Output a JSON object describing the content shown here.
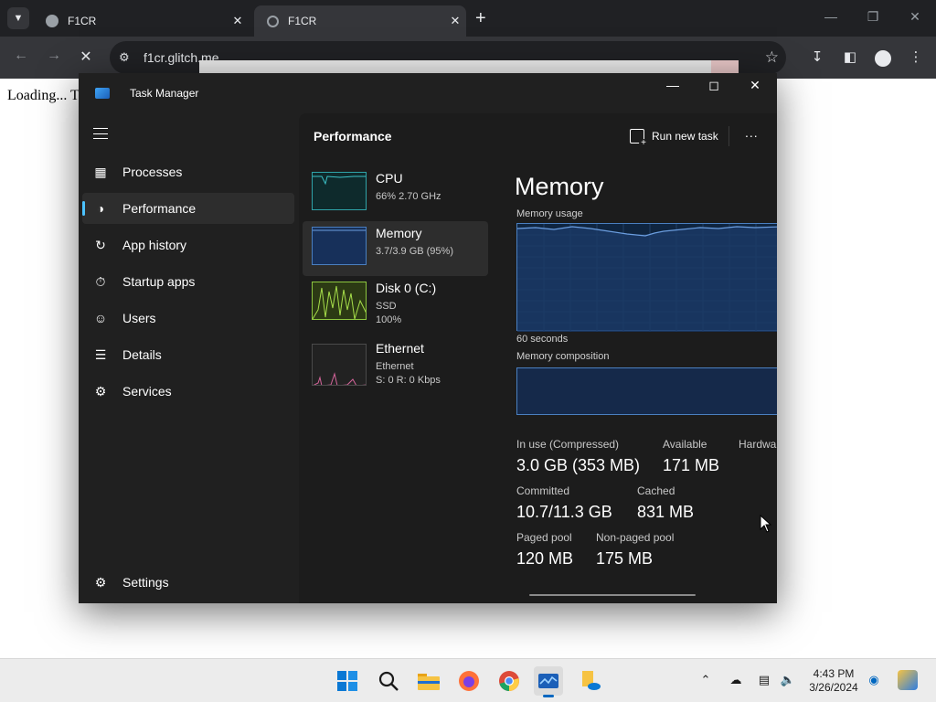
{
  "browser": {
    "tabs": [
      {
        "title": "F1CR"
      },
      {
        "title": "F1CR"
      }
    ],
    "new_tab_glyph": "+",
    "address": "f1cr.glitch.me",
    "page_text": "Loading... T"
  },
  "task_manager": {
    "title": "Task Manager",
    "sidebar": {
      "items": [
        {
          "label": "Processes",
          "icon": "processes-icon",
          "active": false
        },
        {
          "label": "Performance",
          "icon": "performance-icon",
          "active": true
        },
        {
          "label": "App history",
          "icon": "app-history-icon",
          "active": false
        },
        {
          "label": "Startup apps",
          "icon": "startup-apps-icon",
          "active": false
        },
        {
          "label": "Users",
          "icon": "users-icon",
          "active": false
        },
        {
          "label": "Details",
          "icon": "details-icon",
          "active": false
        },
        {
          "label": "Services",
          "icon": "services-icon",
          "active": false
        }
      ],
      "settings_label": "Settings"
    },
    "header": {
      "title": "Performance",
      "run_new_task": "Run new task",
      "more": "..."
    },
    "perf_list": [
      {
        "name": "CPU",
        "line1": "66%  2.70 GHz",
        "line2": "",
        "color": "#2fa3a8",
        "active": false
      },
      {
        "name": "Memory",
        "line1": "3.7/3.9 GB (95%)",
        "line2": "",
        "color": "#4a7fc0",
        "active": true
      },
      {
        "name": "Disk 0 (C:)",
        "line1": "SSD",
        "line2": "100%",
        "color": "#8dc63f",
        "active": false
      },
      {
        "name": "Ethernet",
        "line1": "Ethernet",
        "line2": "S: 0  R: 0 Kbps",
        "color": "#c8558a",
        "active": false
      }
    ],
    "memory": {
      "title": "Memory",
      "usage_label": "Memory usage",
      "time_label": "60 seconds",
      "composition_label": "Memory composition",
      "stats": {
        "in_use_label": "In use (Compressed)",
        "in_use_value": "3.0 GB (353 MB)",
        "available_label": "Available",
        "available_value": "171 MB",
        "hardware_label": "Hardwa",
        "committed_label": "Committed",
        "committed_value": "10.7/11.3 GB",
        "cached_label": "Cached",
        "cached_value": "831 MB",
        "paged_label": "Paged pool",
        "paged_value": "120 MB",
        "nonpaged_label": "Non-paged pool",
        "nonpaged_value": "175 MB"
      }
    }
  },
  "taskbar": {
    "apps": [
      "start-icon",
      "search-icon",
      "file-explorer-icon",
      "firefox-icon",
      "chrome-icon",
      "task-manager-icon",
      "onedrive-icon"
    ],
    "time": "4:43 PM",
    "date": "3/26/2024"
  }
}
